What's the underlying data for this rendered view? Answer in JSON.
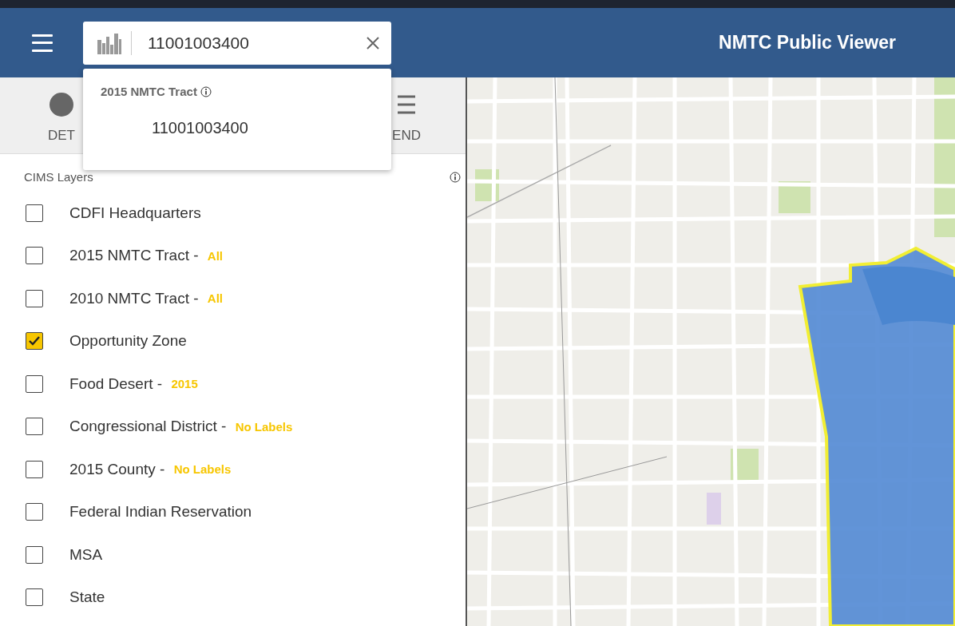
{
  "header": {
    "search": {
      "value": "11001003400"
    },
    "title": "NMTC Public Viewer"
  },
  "dropdown": {
    "group": "2015 NMTC Tract",
    "results": [
      "11001003400"
    ]
  },
  "tabs": [
    {
      "label": "DET"
    },
    {
      "label": "END"
    }
  ],
  "panel": {
    "heading": "CIMS Layers",
    "layers": [
      {
        "name": "CDFI Headquarters",
        "checked": false
      },
      {
        "name": "2015 NMTC Tract - ",
        "tag": "All",
        "checked": false
      },
      {
        "name": "2010 NMTC Tract - ",
        "tag": "All",
        "checked": false
      },
      {
        "name": "Opportunity Zone",
        "checked": true
      },
      {
        "name": "Food Desert - ",
        "tag": "2015",
        "checked": false
      },
      {
        "name": "Congressional District - ",
        "tag": "No Labels",
        "checked": false
      },
      {
        "name": "2015 County - ",
        "tag": "No Labels",
        "checked": false
      },
      {
        "name": "Federal Indian Reservation",
        "checked": false
      },
      {
        "name": "MSA",
        "checked": false
      },
      {
        "name": "State",
        "checked": false
      }
    ]
  }
}
